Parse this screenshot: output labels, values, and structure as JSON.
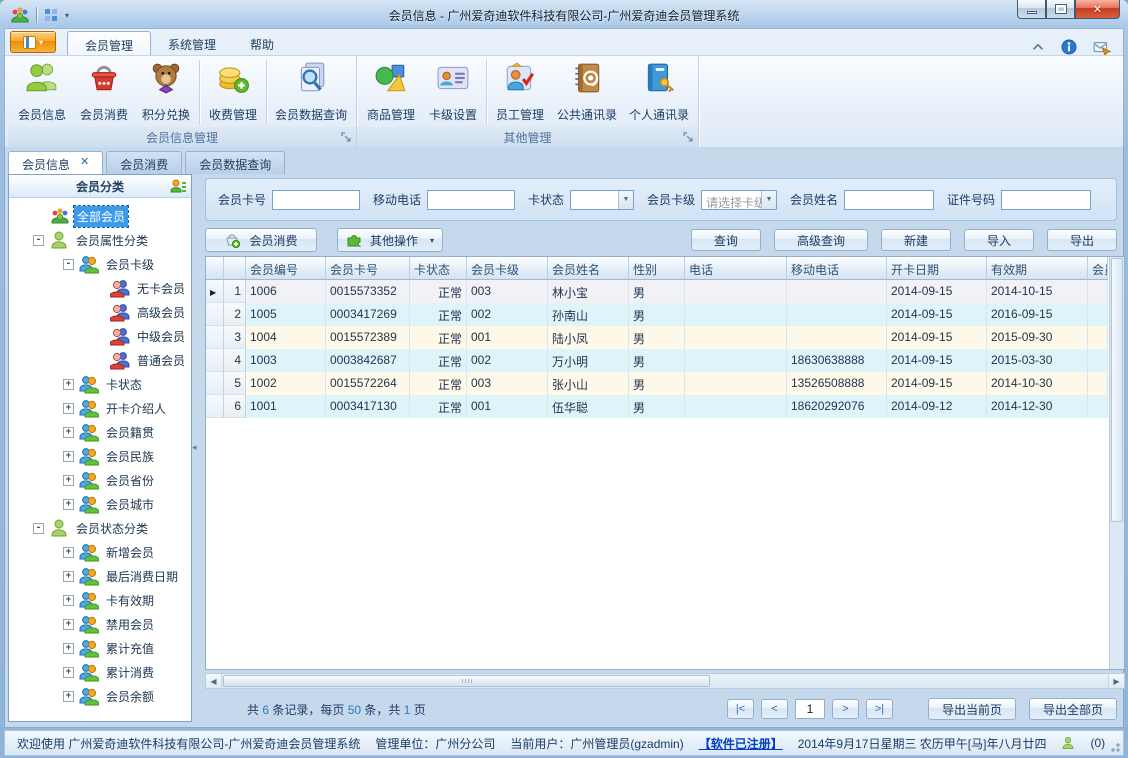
{
  "titlebar": {
    "title": "会员信息 - 广州爱奇迪软件科技有限公司-广州爱奇迪会员管理系统"
  },
  "ribbon_tabs": [
    {
      "label": "会员管理",
      "active": true
    },
    {
      "label": "系统管理",
      "active": false
    },
    {
      "label": "帮助",
      "active": false
    }
  ],
  "ribbon_groups": [
    {
      "label": "会员信息管理",
      "items": [
        {
          "label": "会员信息",
          "icon": "members-icon",
          "sep_after": false
        },
        {
          "label": "会员消费",
          "icon": "basket-icon",
          "sep_after": false
        },
        {
          "label": "积分兑换",
          "icon": "teddy-icon",
          "sep_after": true
        },
        {
          "label": "收费管理",
          "icon": "coins-icon",
          "sep_after": true
        },
        {
          "label": "会员数据查询",
          "icon": "search-doc-icon",
          "sep_after": false
        }
      ]
    },
    {
      "label": "其他管理",
      "items": [
        {
          "label": "商品管理",
          "icon": "goods-icon",
          "sep_after": false
        },
        {
          "label": "卡级设置",
          "icon": "card-icon",
          "sep_after": true
        },
        {
          "label": "员工管理",
          "icon": "staff-icon",
          "sep_after": false
        },
        {
          "label": "公共通讯录",
          "icon": "addressbook-icon",
          "sep_after": false
        },
        {
          "label": "个人通讯录",
          "icon": "personal-book-icon",
          "sep_after": false
        }
      ]
    }
  ],
  "doc_tabs": [
    {
      "label": "会员信息",
      "active": true,
      "closable": true
    },
    {
      "label": "会员消费",
      "active": false,
      "closable": false
    },
    {
      "label": "会员数据查询",
      "active": false,
      "closable": false
    }
  ],
  "sidebar": {
    "header": "会员分类",
    "tree": [
      {
        "label": "全部会员",
        "level": 0,
        "icon": "group-icon",
        "expander": "none",
        "selected": true
      },
      {
        "label": "会员属性分类",
        "level": 0,
        "icon": "person-green-icon",
        "expander": "minus",
        "selected": false
      },
      {
        "label": "会员卡级",
        "level": 1,
        "icon": "duo-orange-icon",
        "expander": "minus",
        "selected": false
      },
      {
        "label": "无卡会员",
        "level": 2,
        "icon": "duo-red-icon",
        "expander": "none",
        "selected": false
      },
      {
        "label": "高级会员",
        "level": 2,
        "icon": "duo-red-icon",
        "expander": "none",
        "selected": false
      },
      {
        "label": "中级会员",
        "level": 2,
        "icon": "duo-red-icon",
        "expander": "none",
        "selected": false
      },
      {
        "label": "普通会员",
        "level": 2,
        "icon": "duo-red-icon",
        "expander": "none",
        "selected": false
      },
      {
        "label": "卡状态",
        "level": 1,
        "icon": "duo-orange-icon",
        "expander": "plus",
        "selected": false
      },
      {
        "label": "开卡介绍人",
        "level": 1,
        "icon": "duo-orange-icon",
        "expander": "plus",
        "selected": false
      },
      {
        "label": "会员籍贯",
        "level": 1,
        "icon": "duo-orange-icon",
        "expander": "plus",
        "selected": false
      },
      {
        "label": "会员民族",
        "level": 1,
        "icon": "duo-orange-icon",
        "expander": "plus",
        "selected": false
      },
      {
        "label": "会员省份",
        "level": 1,
        "icon": "duo-orange-icon",
        "expander": "plus",
        "selected": false
      },
      {
        "label": "会员城市",
        "level": 1,
        "icon": "duo-orange-icon",
        "expander": "plus",
        "selected": false
      },
      {
        "label": "会员状态分类",
        "level": 0,
        "icon": "person-green-icon",
        "expander": "minus",
        "selected": false
      },
      {
        "label": "新增会员",
        "level": 1,
        "icon": "duo-orange-icon",
        "expander": "plus",
        "selected": false
      },
      {
        "label": "最后消费日期",
        "level": 1,
        "icon": "duo-orange-icon",
        "expander": "plus",
        "selected": false
      },
      {
        "label": "卡有效期",
        "level": 1,
        "icon": "duo-orange-icon",
        "expander": "plus",
        "selected": false
      },
      {
        "label": "禁用会员",
        "level": 1,
        "icon": "duo-orange-icon",
        "expander": "plus",
        "selected": false
      },
      {
        "label": "累计充值",
        "level": 1,
        "icon": "duo-orange-icon",
        "expander": "plus",
        "selected": false
      },
      {
        "label": "累计消费",
        "level": 1,
        "icon": "duo-orange-icon",
        "expander": "plus",
        "selected": false
      },
      {
        "label": "会员余额",
        "level": 1,
        "icon": "duo-orange-icon",
        "expander": "plus",
        "selected": false
      }
    ]
  },
  "filters": [
    {
      "label": "会员卡号",
      "type": "input",
      "value": "",
      "placeholder": false
    },
    {
      "label": "移动电话",
      "type": "input",
      "value": "",
      "placeholder": false
    },
    {
      "label": "卡状态",
      "type": "select",
      "value": "",
      "placeholder": false
    },
    {
      "label": "会员卡级",
      "type": "select",
      "value": "请选择卡级",
      "placeholder": true
    },
    {
      "label": "会员姓名",
      "type": "input",
      "value": "",
      "placeholder": false
    },
    {
      "label": "证件号码",
      "type": "input",
      "value": "",
      "placeholder": false
    }
  ],
  "toolbar": {
    "member_consume": "会员消费",
    "other_ops": "其他操作",
    "right_buttons": [
      "查询",
      "高级查询",
      "新建",
      "导入",
      "导出"
    ]
  },
  "table": {
    "columns": [
      "会员编号",
      "会员卡号",
      "卡状态",
      "会员卡级",
      "会员姓名",
      "性别",
      "电话",
      "移动电话",
      "开卡日期",
      "有效期",
      "会员余额"
    ],
    "rows": [
      {
        "num": "1",
        "current": true,
        "cells": [
          "1006",
          "0015573352",
          "正常",
          "003",
          "林小宝",
          "男",
          "",
          "",
          "2014-09-15",
          "2014-10-15",
          ""
        ]
      },
      {
        "num": "2",
        "current": false,
        "cells": [
          "1005",
          "0003417269",
          "正常",
          "002",
          "孙南山",
          "男",
          "",
          "",
          "2014-09-15",
          "2016-09-15",
          ""
        ]
      },
      {
        "num": "3",
        "current": false,
        "cells": [
          "1004",
          "0015572389",
          "正常",
          "001",
          "陆小凤",
          "男",
          "",
          "",
          "2014-09-15",
          "2015-09-30",
          ""
        ]
      },
      {
        "num": "4",
        "current": false,
        "cells": [
          "1003",
          "0003842687",
          "正常",
          "002",
          "万小明",
          "男",
          "",
          "18630638888",
          "2014-09-15",
          "2015-03-30",
          ""
        ]
      },
      {
        "num": "5",
        "current": false,
        "cells": [
          "1002",
          "0015572264",
          "正常",
          "003",
          "张小山",
          "男",
          "",
          "13526508888",
          "2014-09-15",
          "2014-10-30",
          ""
        ]
      },
      {
        "num": "6",
        "current": false,
        "cells": [
          "1001",
          "0003417130",
          "正常",
          "001",
          "伍华聪",
          "男",
          "",
          "18620292076",
          "2014-09-12",
          "2014-12-30",
          ""
        ]
      }
    ]
  },
  "pager": {
    "summary_parts": [
      "共 ",
      "6",
      " 条记录，每页 ",
      "50",
      " 条，共 ",
      "1",
      " 页"
    ],
    "nav_first": "|<",
    "nav_prev": "<",
    "page_value": "1",
    "nav_next": ">",
    "nav_last": ">|",
    "export_current": "导出当前页",
    "export_all": "导出全部页"
  },
  "statusbar": {
    "welcome": "欢迎使用 广州爱奇迪软件科技有限公司-广州爱奇迪会员管理系统",
    "org": "管理单位：广州分公司",
    "user": "当前用户：广州管理员(gzadmin)",
    "registered": "【软件已注册】",
    "date": "2014年9月17日星期三 农历甲午[马]年八月廿四",
    "counter": "(0)"
  }
}
